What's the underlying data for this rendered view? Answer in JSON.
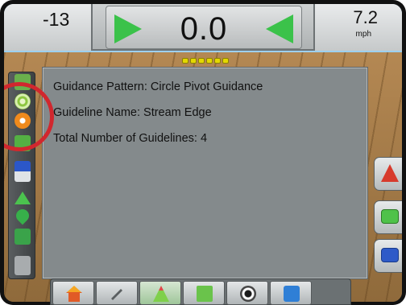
{
  "status_bar": {
    "cross_track_left": "-13",
    "cross_track_value": "0.0",
    "speed_value": "7.2",
    "speed_unit": "mph",
    "arrow_color": "#3bc24a"
  },
  "info_panel": {
    "guidance_pattern": "Guidance Pattern: Circle Pivot Guidance",
    "guideline_name": "Guideline Name: Stream Edge",
    "total_guidelines": "Total Number of Guidelines: 4"
  },
  "left_toolbar": {
    "icons": [
      "guidance-mode-icon",
      "circle-pivot-icon",
      "circle-pivot-selected-icon",
      "sensor-icon",
      "magnet-icon",
      "triangle-icon",
      "drop-icon",
      "lock-icon"
    ]
  },
  "right_buttons": {
    "icons": [
      "guidance-arrow-icon",
      "green-message-icon",
      "blue-message-icon"
    ]
  },
  "bottom_toolbar": {
    "icons": [
      "home-icon",
      "tools-icon",
      "guidance-view-icon",
      "map-icon",
      "camera-icon",
      "data-icon"
    ],
    "active": "guidance-view-icon"
  },
  "highlight_color": "#d1272e"
}
